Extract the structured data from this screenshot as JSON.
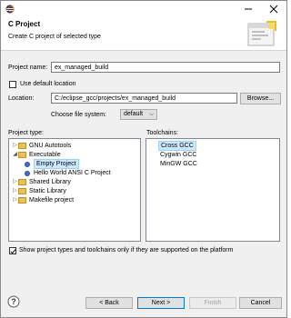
{
  "window": {
    "title": "C Project",
    "description": "Create C project of selected type"
  },
  "form": {
    "project_name_label": "Project name:",
    "project_name_value": "ex_managed_build",
    "use_default_location_label": "Use default location",
    "use_default_location_checked": false,
    "location_label": "Location:",
    "location_value": "C:/eclipse_gcc/projects/ex_managed_build",
    "browse_label": "Browse...",
    "file_system_label": "Choose file system:",
    "file_system_value": "default"
  },
  "project_type": {
    "heading": "Project type:",
    "items": [
      {
        "label": "GNU Autotools",
        "level": 0,
        "expanded": false
      },
      {
        "label": "Executable",
        "level": 0,
        "expanded": true
      },
      {
        "label": "Empty Project",
        "level": 1,
        "selected": true
      },
      {
        "label": "Hello World ANSI C Project",
        "level": 1
      },
      {
        "label": "Shared Library",
        "level": 0,
        "expanded": false
      },
      {
        "label": "Static Library",
        "level": 0,
        "expanded": false
      },
      {
        "label": "Makefile project",
        "level": 0,
        "expanded": false
      }
    ]
  },
  "toolchains": {
    "heading": "Toolchains:",
    "items": [
      {
        "label": "Cross GCC",
        "selected": true
      },
      {
        "label": "Cygwin GCC"
      },
      {
        "label": "MinGW GCC"
      }
    ]
  },
  "filter": {
    "label": "Show project types and toolchains only if they are supported on the platform",
    "checked": true
  },
  "footer": {
    "help": "?",
    "back": "< Back",
    "next": "Next >",
    "finish": "Finish",
    "cancel": "Cancel"
  },
  "colors": {
    "selection": "#cce8ff",
    "accent": "#0078d7"
  }
}
